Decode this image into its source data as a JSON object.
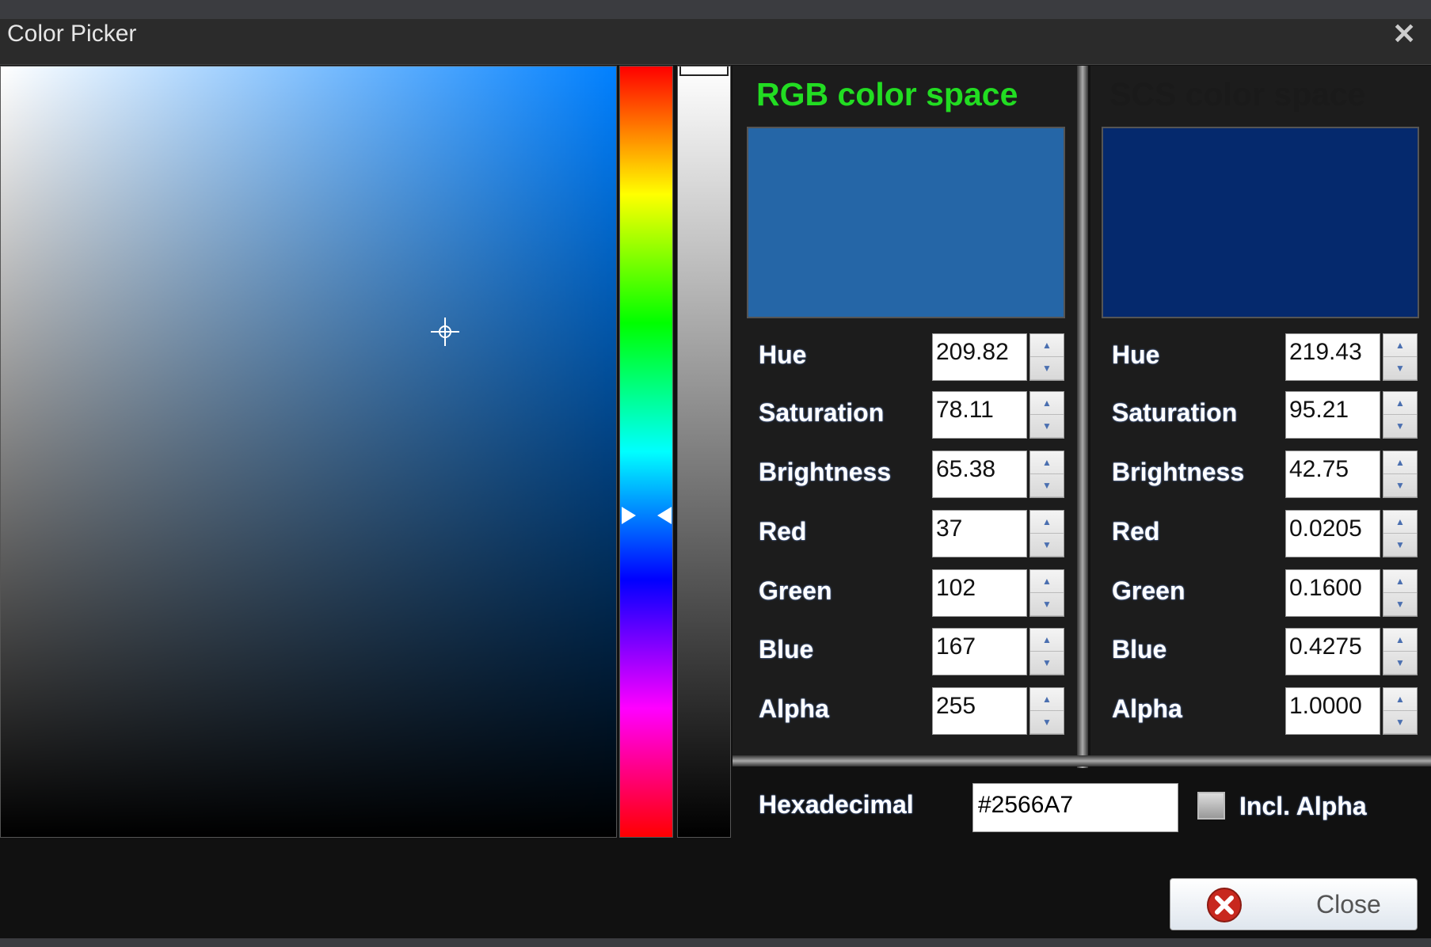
{
  "window": {
    "title": "Color Picker",
    "close_icon": "close-x-icon"
  },
  "picker": {
    "hue_degrees": 209.82
  },
  "rgb": {
    "title": "RGB color space",
    "title_color": "#22dd22",
    "swatch_color": "#2566A7",
    "rows": [
      {
        "label": "Hue",
        "value": "209.82"
      },
      {
        "label": "Saturation",
        "value": "78.11"
      },
      {
        "label": "Brightness",
        "value": "65.38"
      },
      {
        "label": "Red",
        "value": "37"
      },
      {
        "label": "Green",
        "value": "102"
      },
      {
        "label": "Blue",
        "value": "167"
      },
      {
        "label": "Alpha",
        "value": "255"
      }
    ]
  },
  "scs": {
    "title": "SCS color space",
    "title_color": "#1a1a1a",
    "swatch_color": "#05296D",
    "rows": [
      {
        "label": "Hue",
        "value": "219.43"
      },
      {
        "label": "Saturation",
        "value": "95.21"
      },
      {
        "label": "Brightness",
        "value": "42.75"
      },
      {
        "label": "Red",
        "value": "0.0205"
      },
      {
        "label": "Green",
        "value": "0.1600"
      },
      {
        "label": "Blue",
        "value": "0.4275"
      },
      {
        "label": "Alpha",
        "value": "1.0000"
      }
    ]
  },
  "hex": {
    "label": "Hexadecimal",
    "value": "#2566A7"
  },
  "incl_alpha": {
    "label": "Incl. Alpha",
    "checked": false
  },
  "close_button": {
    "label": "Close",
    "icon": "error-circle-icon"
  }
}
